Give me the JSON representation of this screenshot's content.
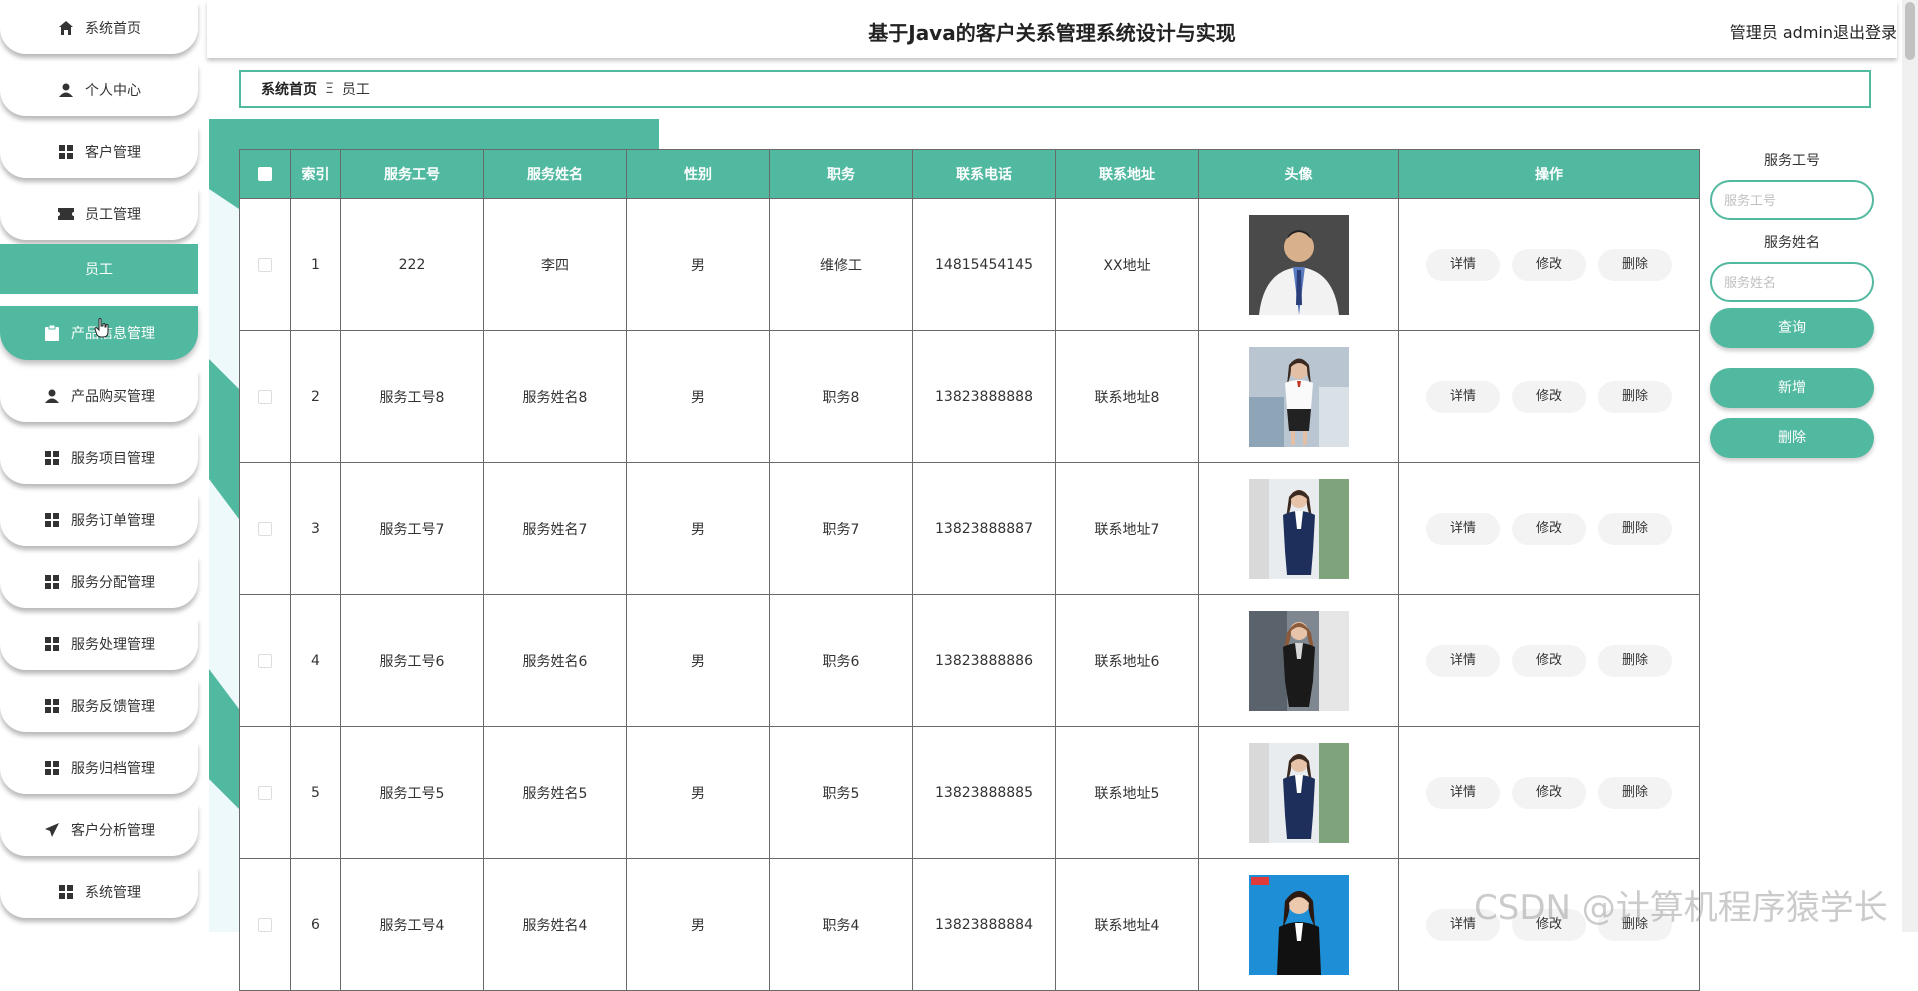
{
  "app": {
    "title": "基于Java的客户关系管理系统设计与实现",
    "user_label": "管理员 admin",
    "logout_label": "退出登录"
  },
  "sidebar": {
    "items": [
      {
        "label": "系统首页",
        "icon": "home-icon"
      },
      {
        "label": "个人中心",
        "icon": "user-icon"
      },
      {
        "label": "客户管理",
        "icon": "grid-icon"
      },
      {
        "label": "员工管理",
        "icon": "ticket-icon"
      },
      {
        "label": "产品信息管理",
        "icon": "clipboard-icon"
      },
      {
        "label": "产品购买管理",
        "icon": "user-icon"
      },
      {
        "label": "服务项目管理",
        "icon": "grid-icon"
      },
      {
        "label": "服务订单管理",
        "icon": "grid-icon"
      },
      {
        "label": "服务分配管理",
        "icon": "grid-icon"
      },
      {
        "label": "服务处理管理",
        "icon": "grid-icon"
      },
      {
        "label": "服务反馈管理",
        "icon": "grid-icon"
      },
      {
        "label": "服务归档管理",
        "icon": "grid-icon"
      },
      {
        "label": "客户分析管理",
        "icon": "send-icon"
      },
      {
        "label": "系统管理",
        "icon": "grid-icon"
      }
    ],
    "sub_item": "员工"
  },
  "breadcrumb": {
    "home": "系统首页",
    "separator": "Ξ",
    "current": "员工"
  },
  "table": {
    "headers": [
      "",
      "索引",
      "服务工号",
      "服务姓名",
      "性别",
      "职务",
      "联系电话",
      "联系地址",
      "头像",
      "操作"
    ],
    "rows": [
      {
        "index": "1",
        "no": "222",
        "name": "李四",
        "gender": "男",
        "job": "维修工",
        "phone": "14815454145",
        "address": "XX地址",
        "avatar": "doctor"
      },
      {
        "index": "2",
        "no": "服务工号8",
        "name": "服务姓名8",
        "gender": "男",
        "job": "职务8",
        "phone": "13823888888",
        "address": "联系地址8",
        "avatar": "white-shirt"
      },
      {
        "index": "3",
        "no": "服务工号7",
        "name": "服务姓名7",
        "gender": "男",
        "job": "职务7",
        "phone": "13823888887",
        "address": "联系地址7",
        "avatar": "navy-suit"
      },
      {
        "index": "4",
        "no": "服务工号6",
        "name": "服务姓名6",
        "gender": "男",
        "job": "职务6",
        "phone": "13823888886",
        "address": "联系地址6",
        "avatar": "black-suit"
      },
      {
        "index": "5",
        "no": "服务工号5",
        "name": "服务姓名5",
        "gender": "男",
        "job": "职务5",
        "phone": "13823888885",
        "address": "联系地址5",
        "avatar": "navy-suit"
      },
      {
        "index": "6",
        "no": "服务工号4",
        "name": "服务姓名4",
        "gender": "男",
        "job": "职务4",
        "phone": "13823888884",
        "address": "联系地址4",
        "avatar": "blue-bg"
      }
    ],
    "actions": {
      "detail": "详情",
      "edit": "修改",
      "delete": "删除"
    }
  },
  "search": {
    "no_label": "服务工号",
    "no_placeholder": "服务工号",
    "name_label": "服务姓名",
    "name_placeholder": "服务姓名",
    "query_button": "查询",
    "add_button": "新增",
    "delete_button": "删除"
  },
  "watermark": "CSDN @计算机程序猿学长",
  "colors": {
    "accent": "#52b9a1"
  }
}
